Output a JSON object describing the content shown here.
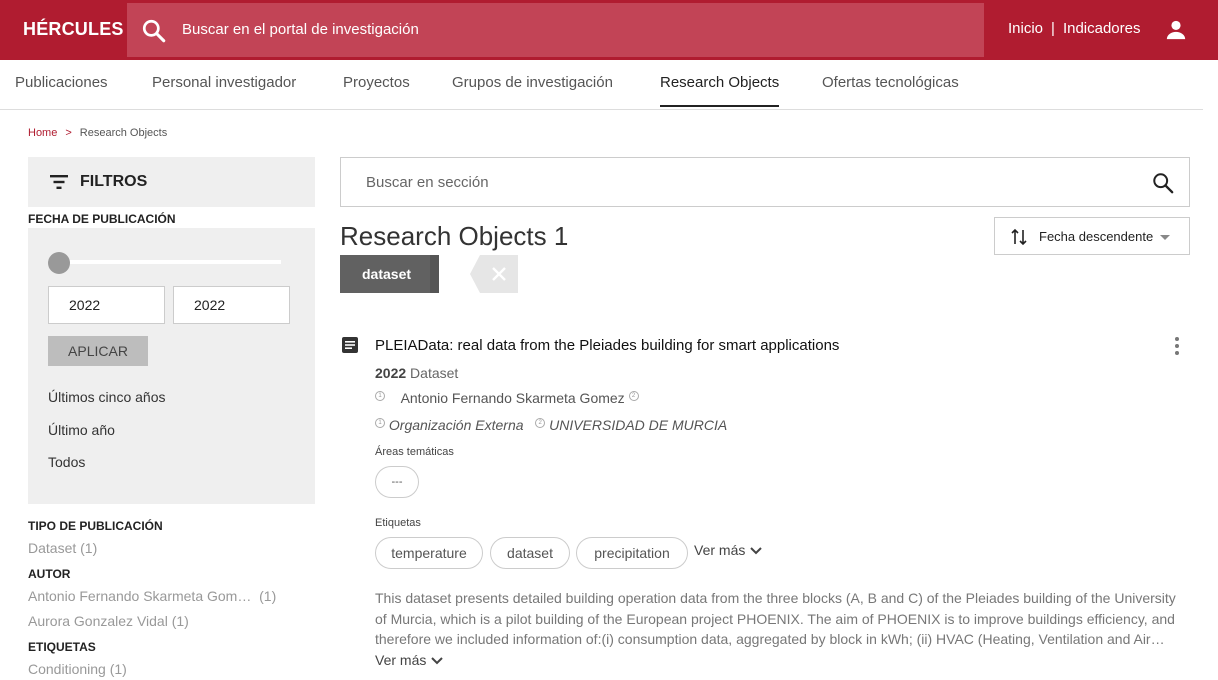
{
  "header": {
    "brand": "HÉRCULES",
    "search_placeholder": "Buscar en el portal de investigación",
    "nav": [
      "Inicio",
      "Indicadores"
    ],
    "nav_separator": "|",
    "accent_color": "#b01c30"
  },
  "tabs": [
    {
      "label": "Publicaciones"
    },
    {
      "label": "Personal investigador"
    },
    {
      "label": "Proyectos"
    },
    {
      "label": "Grupos de investigación"
    },
    {
      "label": "Research Objects",
      "active": true
    },
    {
      "label": "Ofertas tecnológicas"
    }
  ],
  "breadcrumb": {
    "home": "Home",
    "separator": ">",
    "current": "Research Objects"
  },
  "sidebar": {
    "filters_title": "FILTROS",
    "date_section": {
      "title": "FECHA DE PUBLICACIÓN",
      "from": "2022",
      "to": "2022",
      "apply_label": "APLICAR",
      "options": [
        "Últimos cinco años",
        "Último año",
        "Todos"
      ]
    },
    "tipo": {
      "title": "TIPO DE PUBLICACIÓN",
      "items": [
        {
          "label": "Dataset",
          "count": "(1)"
        }
      ]
    },
    "autor": {
      "title": "AUTOR",
      "items": [
        {
          "label": "Antonio Fernando Skarmeta Gom…",
          "count": "(1)"
        },
        {
          "label": "Aurora Gonzalez Vidal",
          "count": "(1)"
        }
      ]
    },
    "etiquetas": {
      "title": "ETIQUETAS",
      "items": [
        {
          "label": "Conditioning",
          "count": "(1)"
        }
      ]
    }
  },
  "main": {
    "search_placeholder": "Buscar en sección",
    "results_title": "Research Objects",
    "results_count": "1",
    "sort_label": "Fecha descendente",
    "active_filter": "dataset",
    "result": {
      "title": "PLEIAData: real data from the Pleiades building for smart applications",
      "year": "2022",
      "type": "Dataset",
      "author_num": "1",
      "author": "Antonio Fernando Skarmeta Gomez",
      "author_num2": "2",
      "org1_num": "1",
      "org1": "Organización Externa",
      "org2_num": "2",
      "org2": "UNIVERSIDAD DE MURCIA",
      "areas_label": "Áreas temáticas",
      "area_placeholder": "---",
      "tags_label": "Etiquetas",
      "tags": [
        "temperature",
        "dataset",
        "precipitation"
      ],
      "ver_mas": "Ver más",
      "description": "This dataset presents detailed building operation data from the three blocks (A, B and C) of the Pleiades building of the University of Murcia, which is a pilot building of the European project PHOENIX. The aim of PHOENIX is to improve buildings efficiency, and therefore we included information of:(i) consumption data, aggregated by block in kWh; (ii) HVAC (Heating, Ventilation and Air…",
      "desc_ver_mas": "Ver más"
    }
  }
}
